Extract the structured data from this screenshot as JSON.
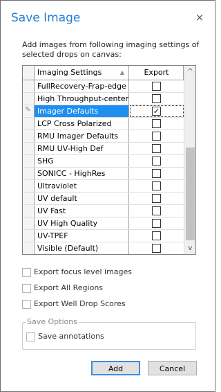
{
  "dialog": {
    "title": "Save Image",
    "close_glyph": "×",
    "instruction": "Add images from following imaging settings of selected drops on canvas:"
  },
  "grid": {
    "columns": {
      "name": "Imaging Settings",
      "export": "Export"
    },
    "rows": [
      {
        "name": "FullRecovery-Frap-edge",
        "checked": false,
        "selected": false
      },
      {
        "name": "High Throughput-center",
        "checked": false,
        "selected": false
      },
      {
        "name": "Imager Defaults",
        "checked": true,
        "selected": true
      },
      {
        "name": "LCP Cross Polarized",
        "checked": false,
        "selected": false
      },
      {
        "name": "RMU Imager Defaults",
        "checked": false,
        "selected": false
      },
      {
        "name": "RMU UV-High Def",
        "checked": false,
        "selected": false
      },
      {
        "name": "SHG",
        "checked": false,
        "selected": false
      },
      {
        "name": "SONICC - HighRes",
        "checked": false,
        "selected": false
      },
      {
        "name": "Ultraviolet",
        "checked": false,
        "selected": false
      },
      {
        "name": "UV default",
        "checked": false,
        "selected": false
      },
      {
        "name": "UV Fast",
        "checked": false,
        "selected": false
      },
      {
        "name": "UV High Quality",
        "checked": false,
        "selected": false
      },
      {
        "name": "UV-TPEF",
        "checked": false,
        "selected": false
      },
      {
        "name": "Visible (Default)",
        "checked": false,
        "selected": false
      }
    ],
    "scroll": {
      "up_glyph": "^",
      "down_glyph": "v",
      "position": 0.5
    }
  },
  "options": {
    "focus_levels": {
      "label": "Export focus level images",
      "checked": false
    },
    "all_regions": {
      "label": "Export All Regions",
      "checked": false
    },
    "well_drop_scores": {
      "label": "Export Well Drop Scores",
      "checked": false
    }
  },
  "save_options": {
    "legend": "Save Options",
    "annotations": {
      "label": "Save annotations",
      "checked": false
    }
  },
  "buttons": {
    "add": "Add",
    "cancel": "Cancel"
  },
  "colors": {
    "title": "#1e7fd2",
    "selection": "#1e8ff0",
    "default_button_border": "#3b8ede"
  },
  "icons": {
    "edit_row": "pencil-icon",
    "checkmark": "checkmark-icon",
    "sort": "sort-arrow-icon"
  }
}
